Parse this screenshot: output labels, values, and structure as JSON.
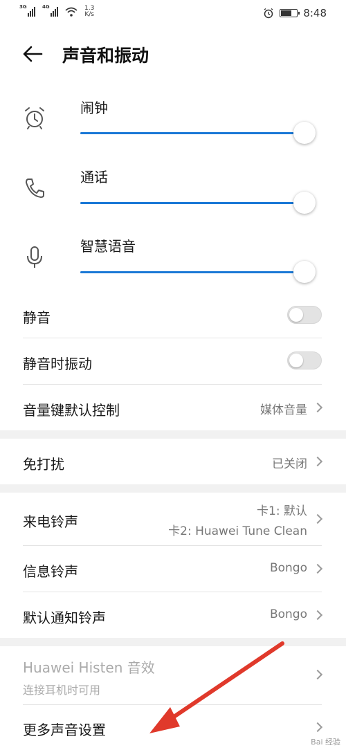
{
  "status_bar": {
    "sim1": "3G",
    "sim2": "4G",
    "speed_value": "1.3",
    "speed_unit": "K/s",
    "time": "8:48",
    "icons": [
      "signal-icon",
      "wifi-icon",
      "alarm-icon",
      "battery-icon"
    ]
  },
  "header": {
    "title": "声音和振动"
  },
  "volumes": [
    {
      "label": "闹钟",
      "icon": "alarm-clock-icon",
      "level": 1.0
    },
    {
      "label": "通话",
      "icon": "phone-icon",
      "level": 1.0
    },
    {
      "label": "智慧语音",
      "icon": "microphone-icon",
      "level": 1.0
    }
  ],
  "settings": {
    "mute_label": "静音",
    "mute_on": false,
    "vibrate_mute_label": "静音时振动",
    "vibrate_mute_on": false,
    "volume_key_label": "音量键默认控制",
    "volume_key_value": "媒体音量",
    "dnd_label": "免打扰",
    "dnd_value": "已关闭",
    "ringtone_label": "来电铃声",
    "ringtone_value_1": "卡1: 默认",
    "ringtone_value_2": "卡2: Huawei Tune Clean",
    "message_tone_label": "信息铃声",
    "message_tone_value": "Bongo",
    "notify_tone_label": "默认通知铃声",
    "notify_tone_value": "Bongo",
    "histen_label": "Huawei Histen 音效",
    "histen_sub": "连接耳机时可用",
    "more_label": "更多声音设置"
  },
  "colors": {
    "accent": "#1a78d6",
    "annotation": "#e0392b"
  },
  "watermark": "Bai 经验"
}
